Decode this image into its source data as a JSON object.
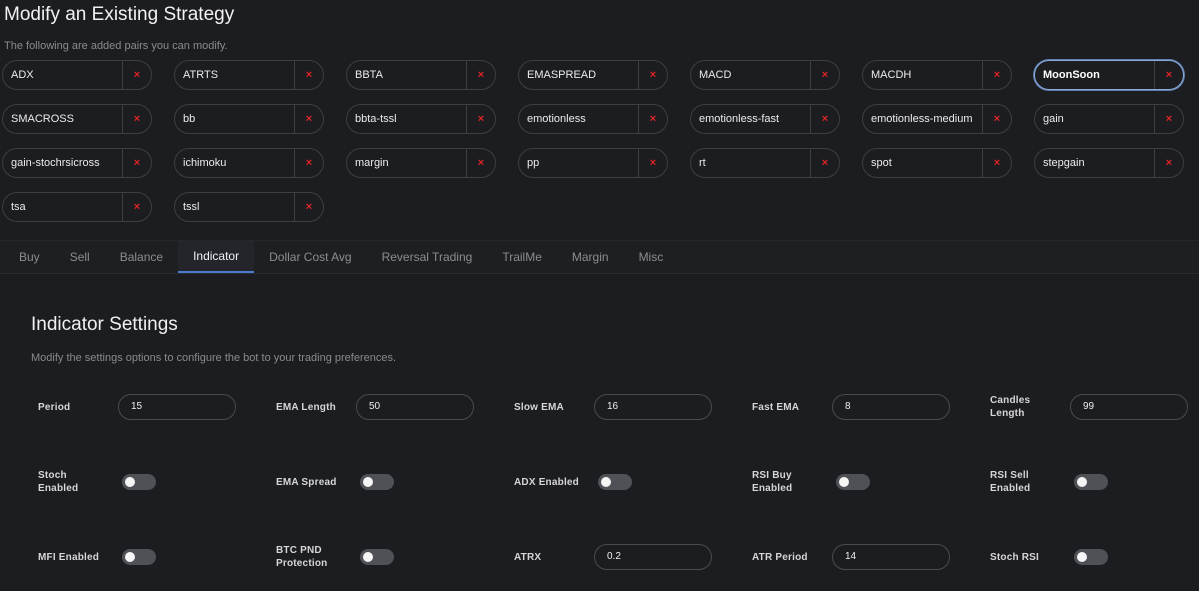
{
  "header": {
    "title": "Modify an Existing Strategy",
    "subtitle": "The following are added pairs you can modify."
  },
  "pairs": [
    "ADX",
    "ATRTS",
    "BBTA",
    "EMASPREAD",
    "MACD",
    "MACDH",
    "MoonSoon",
    "SMACROSS",
    "bb",
    "bbta-tssl",
    "emotionless",
    "emotionless-fast",
    "emotionless-medium",
    "gain",
    "gain-stochrsicross",
    "ichimoku",
    "margin",
    "pp",
    "rt",
    "spot",
    "stepgain",
    "tsa",
    "tssl"
  ],
  "active_pair": "MoonSoon",
  "remove_glyph": "×",
  "tabs": [
    "Buy",
    "Sell",
    "Balance",
    "Indicator",
    "Dollar Cost Avg",
    "Reversal Trading",
    "TrailMe",
    "Margin",
    "Misc"
  ],
  "active_tab": "Indicator",
  "settings": {
    "title": "Indicator Settings",
    "subtitle": "Modify the settings options to configure the bot to your trading preferences.",
    "fields": [
      {
        "label": "Period",
        "type": "input",
        "value": "15"
      },
      {
        "label": "EMA Length",
        "type": "input",
        "value": "50"
      },
      {
        "label": "Slow EMA",
        "type": "input",
        "value": "16"
      },
      {
        "label": "Fast EMA",
        "type": "input",
        "value": "8"
      },
      {
        "label": "Candles Length",
        "type": "input",
        "value": "99"
      },
      {
        "label": "Stoch Enabled",
        "type": "toggle",
        "value": false
      },
      {
        "label": "EMA Spread",
        "type": "toggle",
        "value": false
      },
      {
        "label": "ADX Enabled",
        "type": "toggle",
        "value": false
      },
      {
        "label": "RSI Buy Enabled",
        "type": "toggle",
        "value": false
      },
      {
        "label": "RSI Sell Enabled",
        "type": "toggle",
        "value": false
      },
      {
        "label": "MFI Enabled",
        "type": "toggle",
        "value": false
      },
      {
        "label": "BTC PND Protection",
        "type": "toggle",
        "value": false
      },
      {
        "label": "ATRX",
        "type": "input",
        "value": "0.2"
      },
      {
        "label": "ATR Period",
        "type": "input",
        "value": "14"
      },
      {
        "label": "Stoch RSI",
        "type": "toggle",
        "value": false
      }
    ]
  },
  "colors": {
    "background": "#1c1d20",
    "remove_x": "#e02424",
    "tab_underline": "#4a7bd0",
    "active_pair_border": "#8aa9d6"
  }
}
